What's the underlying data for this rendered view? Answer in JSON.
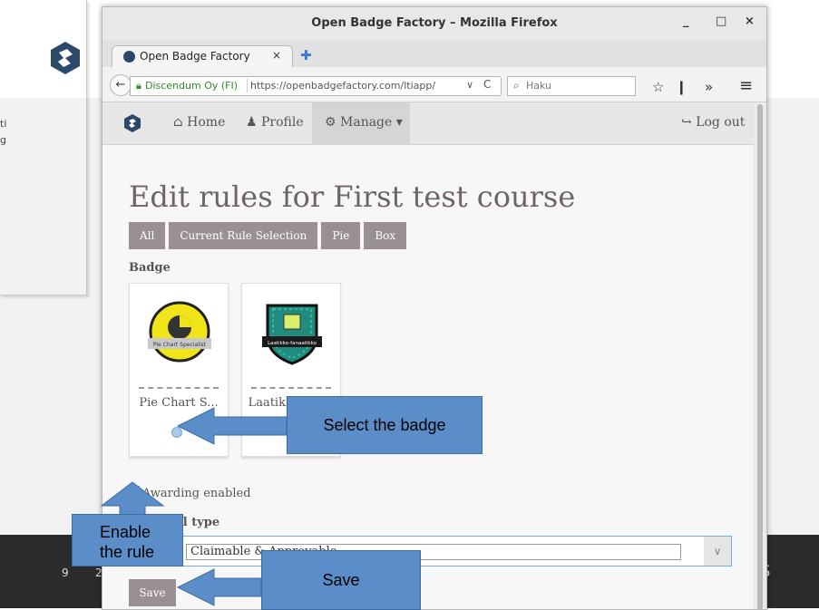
{
  "window": {
    "title": "Open Badge Factory – Mozilla Firefox",
    "minimize": "_",
    "maximize": "□",
    "close": "×"
  },
  "tab": {
    "label": "Open Badge Factory",
    "close": "×",
    "new_tab": "✚"
  },
  "navbar": {
    "back": "←",
    "site_identity": "Discendum Oy (FI)",
    "url": "https://openbadgefactory.com/ltiapp/",
    "reload": "C",
    "search_placeholder": "Haku",
    "bookmark": "☆",
    "reader": "❙",
    "overflow": "»",
    "menu": "≡"
  },
  "site_nav": {
    "home": "Home",
    "profile": "Profile",
    "manage": "Manage",
    "logout": "Log out"
  },
  "page": {
    "title": "Edit rules for First test course",
    "filters": [
      "All",
      "Current Rule Selection",
      "Pie",
      "Box"
    ],
    "badge_label": "Badge",
    "badges": [
      {
        "name": "Pie Chart S...",
        "ribbon": "Pie Chart Specialist",
        "selected": true
      },
      {
        "name": "Laatikko-fan...",
        "ribbon": "Laatikko-fanaatikko",
        "selected": false
      }
    ],
    "awarding_enabled": "Awarding enabled",
    "approval_label": "Approval type",
    "approval_value": "Claimable & Approvable",
    "save": "Save"
  },
  "annotations": {
    "select_badge": "Select the badge",
    "enable_rule_line1": "Enable",
    "enable_rule_line2": "the rule",
    "save": "Save"
  },
  "background": {
    "text_line1": "ti",
    "text_line2": "g",
    "footer_num1": "9",
    "footer_num2": "2",
    "footer_letter": "S"
  },
  "colors": {
    "callout": "#5b8ec9",
    "button": "#9a8f92",
    "title": "#6e6466"
  }
}
